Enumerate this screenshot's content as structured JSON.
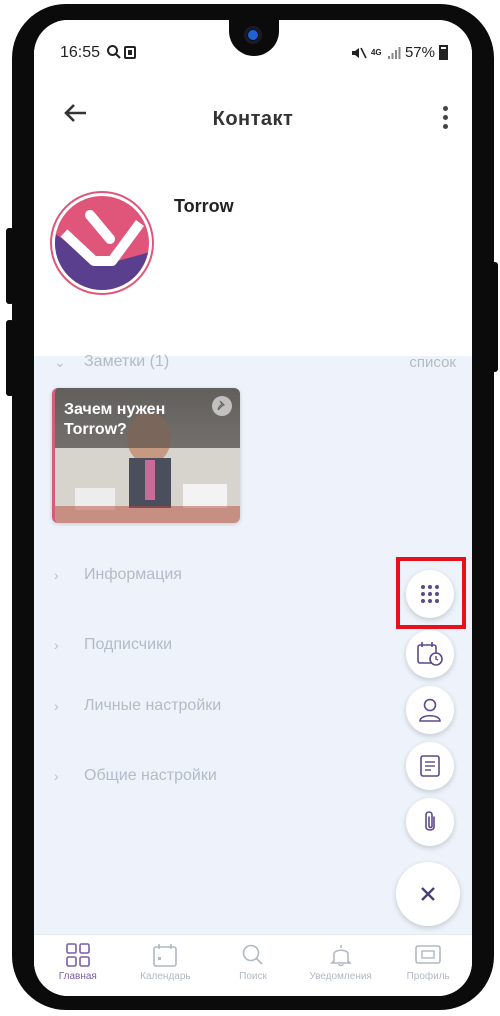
{
  "status_bar": {
    "time": "16:55",
    "battery": "57%",
    "network": "4G"
  },
  "header": {
    "title": "Контакт"
  },
  "contact": {
    "name": "Torrow"
  },
  "notes_section": {
    "label": "Заметки (1)",
    "action": "список",
    "notes": [
      {
        "title": "Зачем нужен Torrow?"
      }
    ]
  },
  "sections": [
    {
      "label": "Информация"
    },
    {
      "label": "Подписчики"
    },
    {
      "label": "Личные настройки"
    },
    {
      "label": "Общие настройки"
    }
  ],
  "fab_menu": {
    "items": [
      "apps-grid-icon",
      "calendar-clock-icon",
      "person-icon",
      "document-icon",
      "paperclip-icon",
      "close-icon"
    ]
  },
  "bottom_nav": {
    "items": [
      {
        "label": "Главная",
        "icon": "home-grid-icon",
        "active": true
      },
      {
        "label": "Календарь",
        "icon": "calendar-icon",
        "active": false
      },
      {
        "label": "Поиск",
        "icon": "search-icon",
        "active": false
      },
      {
        "label": "Уведомления",
        "icon": "bell-icon",
        "active": false
      },
      {
        "label": "Профиль",
        "icon": "profile-card-icon",
        "active": false
      }
    ]
  },
  "colors": {
    "accent": "#7a5ea6",
    "highlight": "#e8101a",
    "brand_pink": "#e0557a",
    "brand_purple": "#5b3f8f"
  }
}
